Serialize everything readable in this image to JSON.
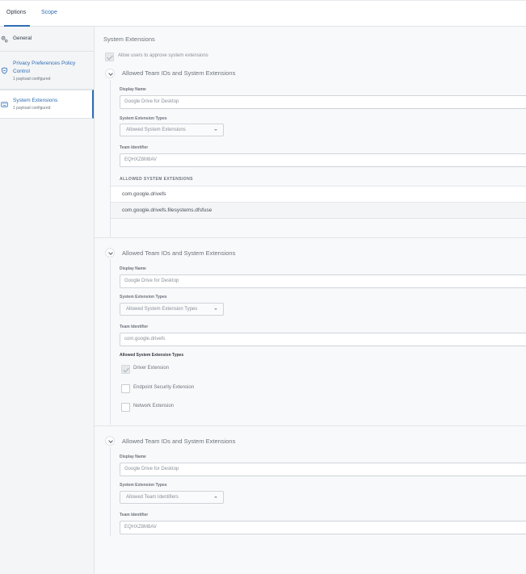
{
  "tabs": [
    {
      "label": "Options"
    },
    {
      "label": "Scope"
    }
  ],
  "sidebar": {
    "items": [
      {
        "title": "General",
        "subtitle": "",
        "icon": "gear-icon"
      },
      {
        "title": "Privacy Preferences Policy Control",
        "subtitle": "1 payload configured",
        "icon": "shield-icon"
      },
      {
        "title": "System Extensions",
        "subtitle": "1 payload configured",
        "icon": "keyboard-icon"
      }
    ]
  },
  "main": {
    "title": "System Extensions",
    "allow_users_label": "Allow users to approve system extensions",
    "sections": [
      {
        "title": "Allowed Team IDs and System Extensions",
        "display_name_label": "Display Name",
        "display_name_value": "Google Drive for Desktop",
        "types_label": "System Extension Types",
        "types_value": "Allowed System Extensions",
        "team_label": "Team Identifier",
        "team_value": "EQHXZ8M8AV",
        "list_header": "ALLOWED SYSTEM EXTENSIONS",
        "extensions": [
          "com.google.drivefs",
          "com.google.drivefs.filesystems.dfsfuse"
        ]
      },
      {
        "title": "Allowed Team IDs and System Extensions",
        "display_name_label": "Display Name",
        "display_name_value": "Google Drive for Desktop",
        "types_label": "System Extension Types",
        "types_value": "Allowed System Extension Types",
        "team_label": "Team Identifier",
        "team_value": "com.google.drivefs",
        "types_header": "Allowed System Extension Types",
        "type_options": [
          {
            "label": "Driver Extension",
            "checked": true
          },
          {
            "label": "Endpoint Security Extension",
            "checked": false
          },
          {
            "label": "Network Extension",
            "checked": false
          }
        ]
      },
      {
        "title": "Allowed Team IDs and System Extensions",
        "display_name_label": "Display Name",
        "display_name_value": "Google Drive for Desktop",
        "types_label": "System Extension Types",
        "types_value": "Allowed Team Identifiers",
        "team_label": "Team Identifier",
        "team_value": "EQHXZ8M8AV"
      }
    ]
  }
}
